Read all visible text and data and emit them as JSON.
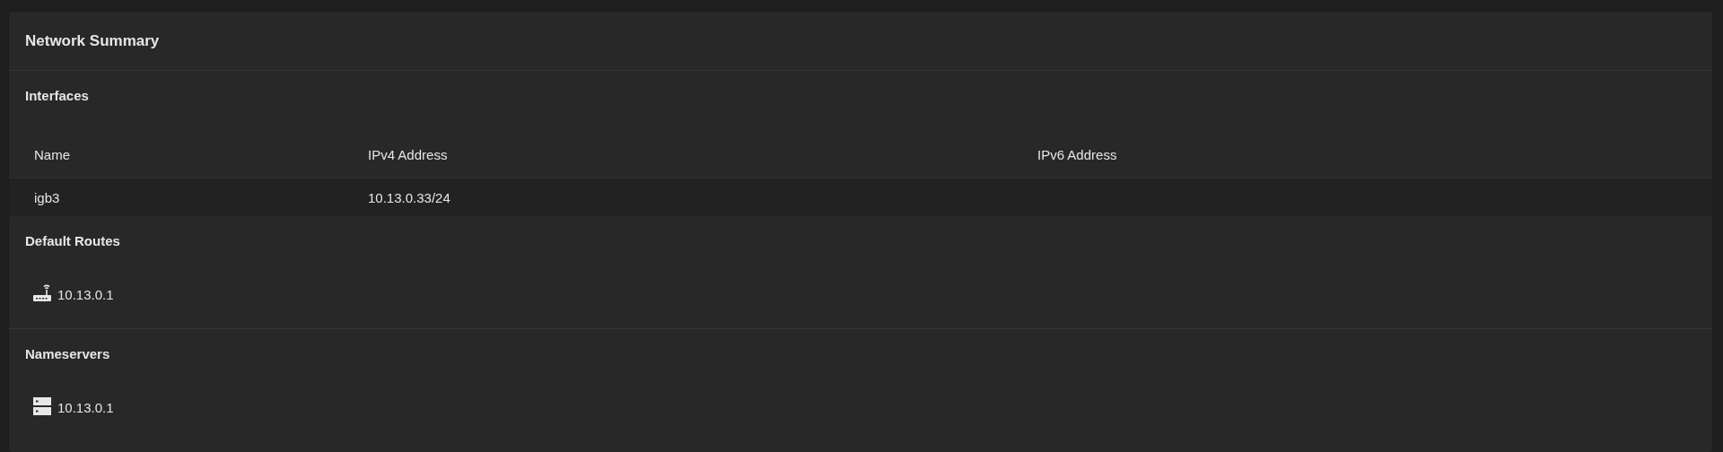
{
  "card": {
    "title": "Network Summary"
  },
  "interfaces": {
    "title": "Interfaces",
    "table": {
      "columns": [
        "Name",
        "IPv4 Address",
        "IPv6 Address"
      ],
      "rows": [
        [
          "igb3",
          "10.13.0.33/24"
        ]
      ]
    }
  },
  "default_routes": {
    "title": "Default Routes",
    "items": [
      "10.13.0.1"
    ]
  },
  "nameservers": {
    "title": "Nameservers",
    "items": [
      "10.13.0.1"
    ]
  }
}
